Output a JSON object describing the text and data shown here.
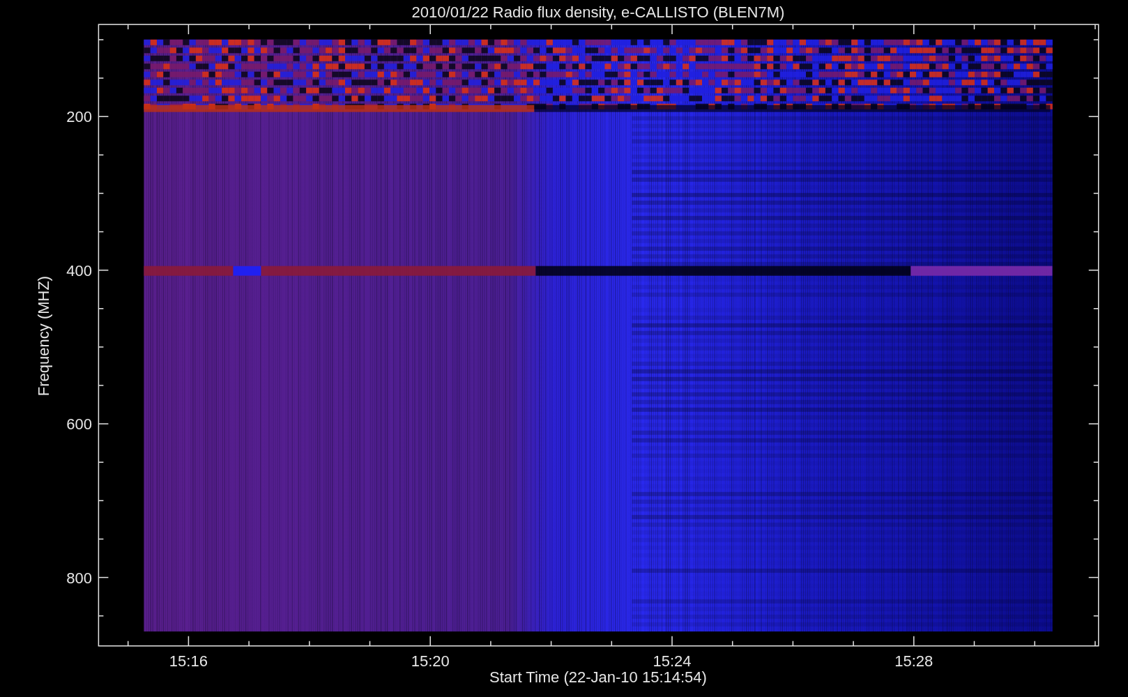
{
  "title": "2010/01/22  Radio flux density, e-CALLISTO (BLEN7M)",
  "y_axis": {
    "label": "Frequency (MHZ)",
    "ticks": [
      "200",
      "400",
      "600",
      "800"
    ]
  },
  "x_axis": {
    "label": "Start Time (22-Jan-10 15:14:54)",
    "ticks": [
      "15:16",
      "15:20",
      "15:24",
      "15:28"
    ]
  }
}
